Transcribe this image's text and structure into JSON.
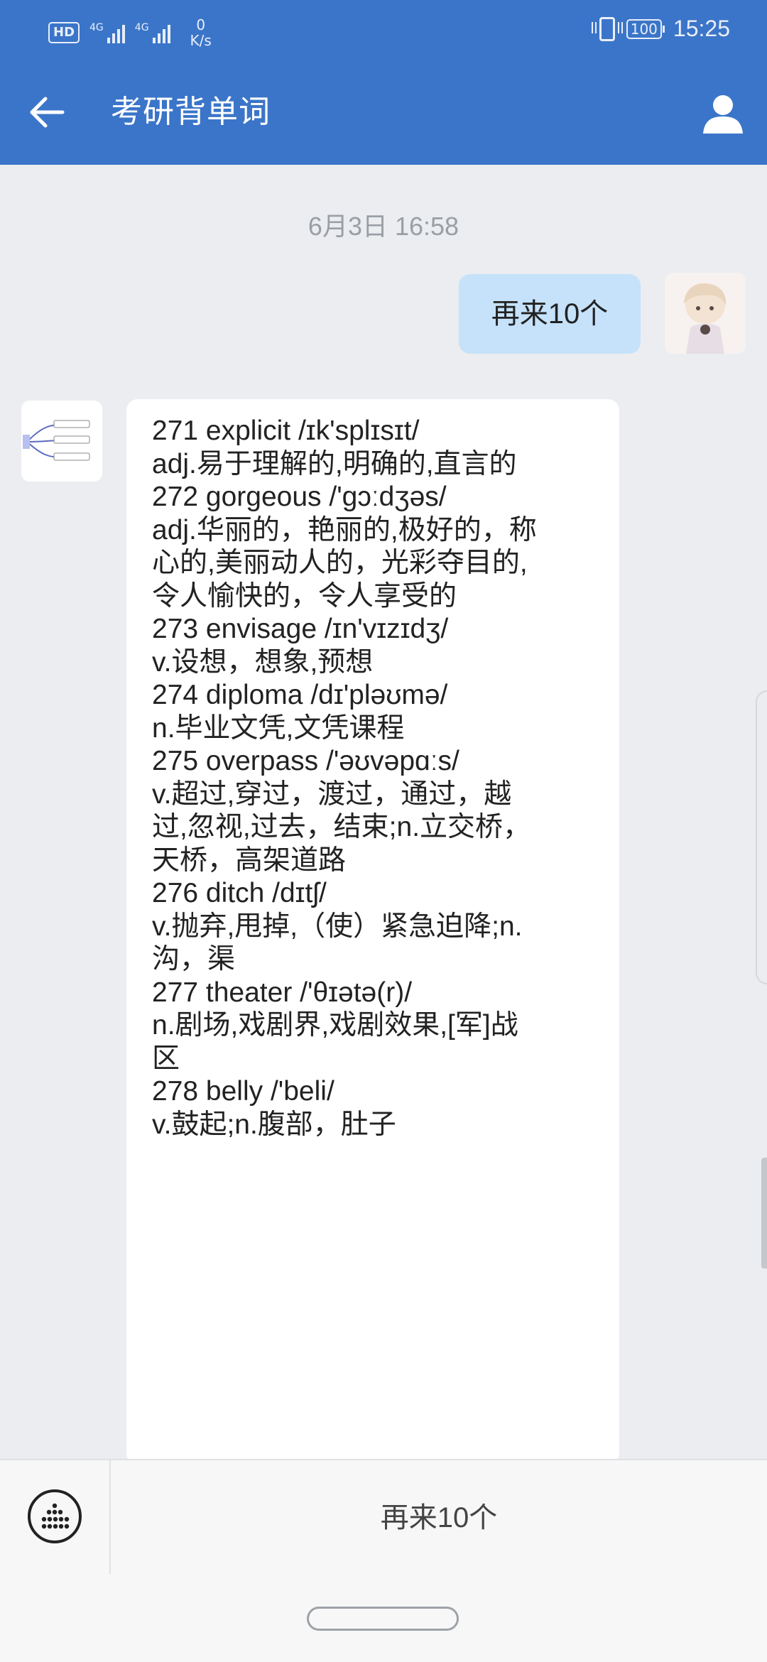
{
  "status_bar": {
    "hd": "HD",
    "sim1": "4G",
    "sim2": "4G",
    "net_speed": "0",
    "net_unit": "K/s",
    "battery": "100",
    "time": "15:25"
  },
  "header": {
    "title": "考研背单词",
    "back_icon": "arrow-left-icon",
    "profile_icon": "person-icon"
  },
  "chat": {
    "timestamp": "6月3日 16:58",
    "user_message": "再来10个",
    "bot_lines": [
      "271 explicit  /ɪk'splɪsɪt/",
      "adj.易于理解的,明确的,直言的",
      "272 gorgeous  /'gɔːdʒəs/",
      "adj.华丽的，艳丽的,极好的，称",
      "心的,美丽动人的，光彩夺目的,",
      "令人愉快的，令人享受的",
      "273 envisage  /ɪn'vɪzɪdʒ/",
      "v.设想，想象,预想",
      "274 diploma  /dɪ'pləʊmə/",
      "n.毕业文凭,文凭课程",
      "275 overpass  /'əʊvəpɑːs/",
      "v.超过,穿过，渡过，通过，越",
      "过,忽视,过去，结束;n.立交桥，",
      "天桥，高架道路",
      "276 ditch  /dɪtʃ/",
      "v.抛弃,甩掉,（使）紧急迫降;n.",
      "沟，渠",
      "277 theater  /'θɪətə(r)/",
      "n.剧场,戏剧界,戏剧效果,[军]战",
      "区",
      "278 belly  /'beli/",
      "v.鼓起;n.腹部，肚子"
    ]
  },
  "bottom_bar": {
    "menu_icon": "dots-grid-icon",
    "quick_reply": "再来10个"
  },
  "colors": {
    "header": "#3b75c9",
    "background": "#ebedf0",
    "user_bubble": "#c6e2fb",
    "bot_bubble": "#ffffff"
  }
}
